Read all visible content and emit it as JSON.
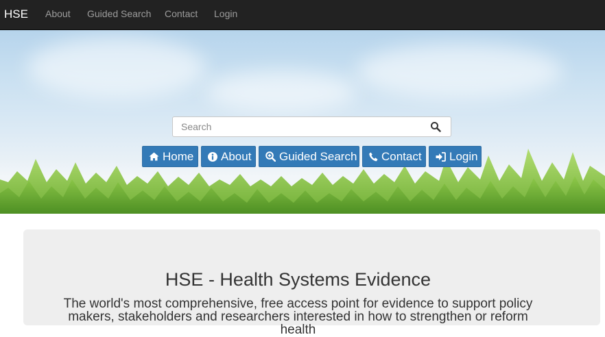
{
  "navbar": {
    "brand": "HSE",
    "links": [
      "About",
      "Guided Search",
      "Contact",
      "Login"
    ]
  },
  "hero": {
    "search_placeholder": "Search",
    "buttons": [
      {
        "label": "Home",
        "icon": "home-icon"
      },
      {
        "label": "About",
        "icon": "info-icon"
      },
      {
        "label": "Guided Search",
        "icon": "zoom-in-icon"
      },
      {
        "label": "Contact",
        "icon": "phone-icon"
      },
      {
        "label": "Login",
        "icon": "login-icon"
      }
    ]
  },
  "jumbotron": {
    "title": "HSE - Health Systems Evidence",
    "text": "The world's most comprehensive, free access point for evidence to support policy makers, stakeholders and researchers interested in how to strengthen or reform health"
  },
  "colors": {
    "navbar_bg": "#222222",
    "nav_link": "#9d9d9d",
    "button_primary": "#337ab7",
    "jumbotron_bg": "#eeeeee"
  }
}
